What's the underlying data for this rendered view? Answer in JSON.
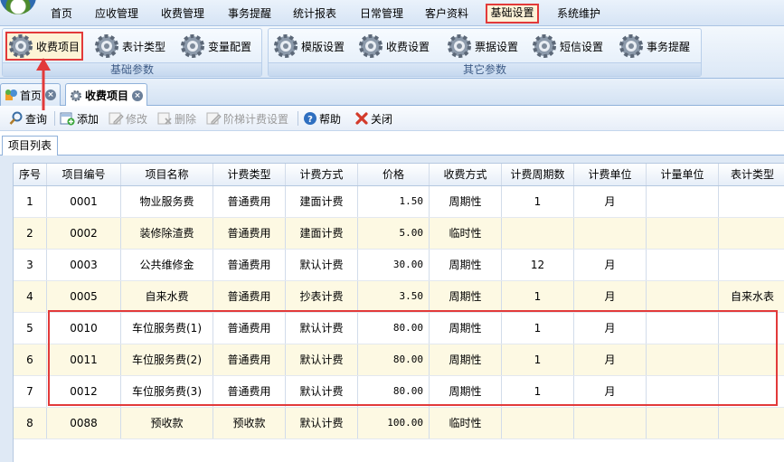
{
  "menu": {
    "items": [
      "首页",
      "应收管理",
      "收费管理",
      "事务提醒",
      "统计报表",
      "日常管理",
      "客户资料",
      "基础设置",
      "系统维护"
    ],
    "active": "基础设置"
  },
  "ribbon": {
    "group1": {
      "title": "基础参数",
      "buttons": [
        "收费项目",
        "表计类型",
        "变量配置"
      ]
    },
    "group2": {
      "title": "其它参数",
      "buttons": [
        "模版设置",
        "收费设置",
        "票据设置",
        "短信设置",
        "事务提醒"
      ]
    },
    "highlighted_button": "收费项目"
  },
  "tabs": [
    {
      "label": "首页",
      "icon": "home-icon"
    },
    {
      "label": "收费项目",
      "icon": "gear-icon"
    }
  ],
  "toolbar": {
    "query": "查询",
    "add": "添加",
    "edit": "修改",
    "delete": "删除",
    "tiered": "阶梯计费设置",
    "help": "帮助",
    "close": "关闭"
  },
  "panel": {
    "title": "项目列表"
  },
  "grid": {
    "columns": [
      "序号",
      "项目编号",
      "项目名称",
      "计费类型",
      "计费方式",
      "价格",
      "收费方式",
      "计费周期数",
      "计费单位",
      "计量单位",
      "表计类型"
    ],
    "rows": [
      [
        "1",
        "0001",
        "物业服务费",
        "普通费用",
        "建面计费",
        "1.50",
        "周期性",
        "1",
        "月",
        "",
        ""
      ],
      [
        "2",
        "0002",
        "装修除渣费",
        "普通费用",
        "建面计费",
        "5.00",
        "临时性",
        "",
        "",
        "",
        ""
      ],
      [
        "3",
        "0003",
        "公共维修金",
        "普通费用",
        "默认计费",
        "30.00",
        "周期性",
        "12",
        "月",
        "",
        ""
      ],
      [
        "4",
        "0005",
        "自来水费",
        "普通费用",
        "抄表计费",
        "3.50",
        "周期性",
        "1",
        "月",
        "",
        "自来水表"
      ],
      [
        "5",
        "0010",
        "车位服务费(1)",
        "普通费用",
        "默认计费",
        "80.00",
        "周期性",
        "1",
        "月",
        "",
        ""
      ],
      [
        "6",
        "0011",
        "车位服务费(2)",
        "普通费用",
        "默认计费",
        "80.00",
        "周期性",
        "1",
        "月",
        "",
        ""
      ],
      [
        "7",
        "0012",
        "车位服务费(3)",
        "普通费用",
        "默认计费",
        "80.00",
        "周期性",
        "1",
        "月",
        "",
        ""
      ],
      [
        "8",
        "0088",
        "预收款",
        "预收款",
        "默认计费",
        "100.00",
        "临时性",
        "",
        "",
        "",
        ""
      ]
    ]
  },
  "colors": {
    "highlight": "#e23a3a",
    "alt_row": "#fdf9e3"
  }
}
